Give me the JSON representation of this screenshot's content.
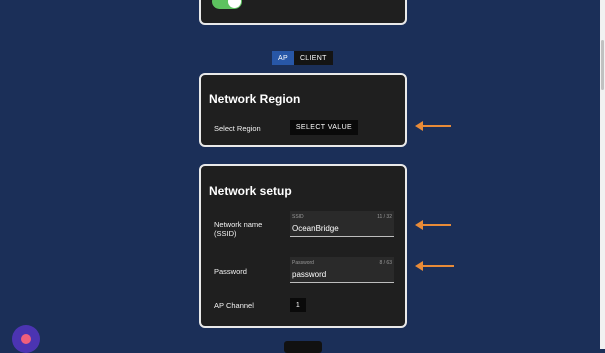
{
  "mode_switch": {
    "ap_label": "AP",
    "client_label": "CLIENT",
    "selected": "AP"
  },
  "region_card": {
    "title": "Network Region",
    "select_label": "Select Region",
    "select_button": "SELECT VALUE"
  },
  "setup_card": {
    "title": "Network setup",
    "ssid": {
      "label": "Network name (SSID)",
      "placeholder": "SSID",
      "counter": "11 / 32",
      "value": "OceanBridge"
    },
    "password": {
      "label": "Password",
      "placeholder": "Password",
      "counter": "8 / 63",
      "value": "password"
    },
    "channel": {
      "label": "AP Channel",
      "value": "1"
    }
  },
  "colors": {
    "background": "#1b2f58",
    "card": "#1f1f1f",
    "accent": "#2857a7",
    "toggle_on": "#5dc25f",
    "annotation_arrow": "#e88b38",
    "fab": "#4b34b2"
  },
  "toggle": {
    "state": "on"
  }
}
